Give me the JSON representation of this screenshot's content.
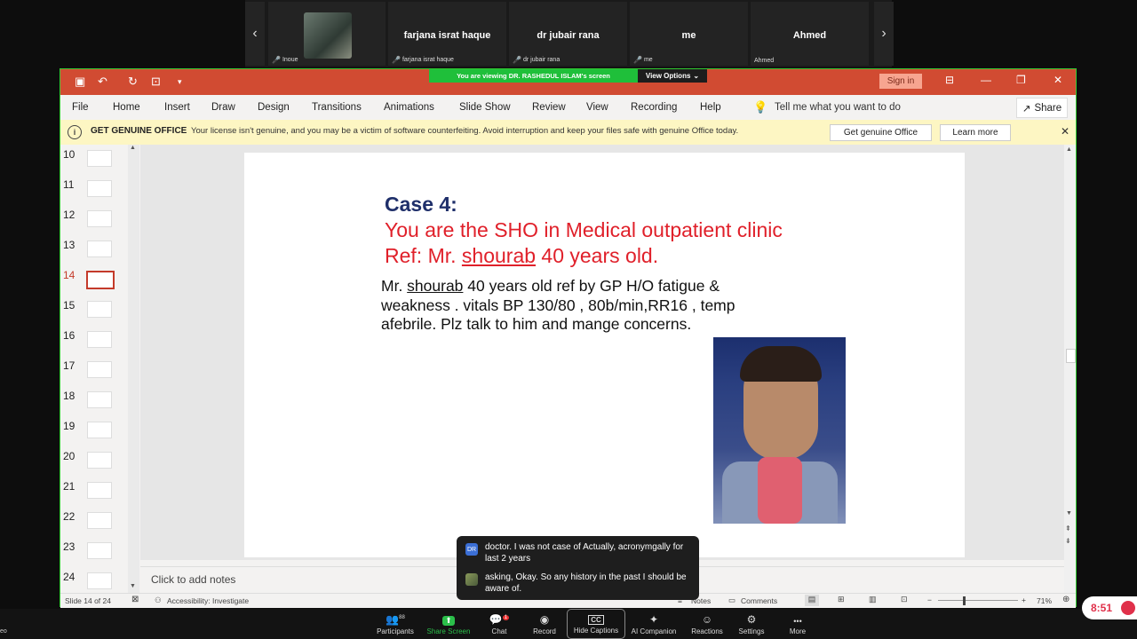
{
  "participants": [
    {
      "name": "",
      "tag": "Inoue",
      "muted": true
    },
    {
      "name": "farjana israt haque",
      "tag": "farjana israt haque",
      "muted": true
    },
    {
      "name": "dr jubair rana",
      "tag": "dr jubair rana",
      "muted": true
    },
    {
      "name": "me",
      "tag": "me",
      "muted": true
    },
    {
      "name": "Ahmed",
      "tag": "Ahmed",
      "muted": false
    }
  ],
  "nav": {
    "prev": "‹",
    "next": "›"
  },
  "banner": {
    "viewing": "You are viewing DR. RASHEDUL ISLAM's screen",
    "view_options": "View Options"
  },
  "window": {
    "sign_in": "Sign in",
    "min": "—",
    "restore": "❐",
    "close": "✕"
  },
  "ribbon": {
    "tabs": [
      "File",
      "Home",
      "Insert",
      "Draw",
      "Design",
      "Transitions",
      "Animations",
      "Slide Show",
      "Review",
      "View",
      "Recording",
      "Help"
    ],
    "tell": "Tell me what you want to do",
    "share": "Share"
  },
  "message": {
    "title": "GET GENUINE OFFICE",
    "text": "Your license isn't genuine, and you may be a victim of software counterfeiting. Avoid interruption and keep your files safe with genuine Office today.",
    "btn1": "Get genuine Office",
    "btn2": "Learn more",
    "close": "✕"
  },
  "thumbs": [
    "10",
    "11",
    "12",
    "13",
    "14",
    "15",
    "16",
    "17",
    "18",
    "19",
    "20",
    "21",
    "22",
    "23",
    "24"
  ],
  "slide": {
    "heading": "Case 4:",
    "line1": "You are the SHO in Medical outpatient clinic",
    "line2_pre": "Ref: Mr. ",
    "line2_name": "shourab",
    "line2_post": " 40 years old.",
    "body_pre": "Mr. ",
    "body_name": "shourab",
    "body_1": "  40 years old ref by GP H/O fatigue &",
    "body_2": "weakness . vitals BP 130/80 , 80b/min,RR16 , temp",
    "body_3": "afebrile. Plz talk to him and mange concerns."
  },
  "notes": "Click to add notes",
  "status": {
    "slide": "Slide 14 of 24",
    "access": "Accessibility: Investigate",
    "notes": "Notes",
    "comments": "Comments",
    "zoom": "71%"
  },
  "captions": [
    {
      "avatar": "DR",
      "text": "doctor. I was not case of Actually, acronymgally for last 2 years"
    },
    {
      "avatar": "",
      "text": "asking, Okay. So any history in the past I should be aware of."
    }
  ],
  "toolbar": [
    {
      "label": "Participants",
      "icon": "👥",
      "count": "88"
    },
    {
      "label": "Share Screen",
      "icon": "⬆"
    },
    {
      "label": "Chat",
      "icon": "💬",
      "count": "1"
    },
    {
      "label": "Record",
      "icon": "◉"
    },
    {
      "label": "Hide Captions",
      "icon": "CC"
    },
    {
      "label": "AI Companion",
      "icon": "✦"
    },
    {
      "label": "Reactions",
      "icon": "☺"
    },
    {
      "label": "Settings",
      "icon": "⚙"
    },
    {
      "label": "More",
      "icon": "•••"
    }
  ],
  "time": "8:51",
  "left_edge": "eo"
}
